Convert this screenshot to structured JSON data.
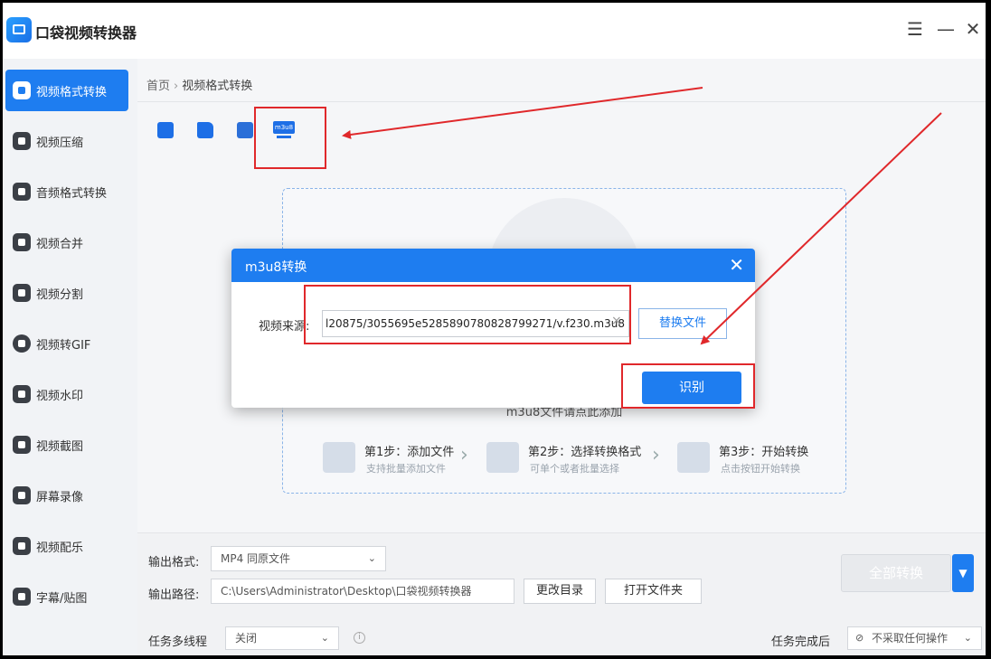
{
  "app": {
    "title": "口袋视频转换器"
  },
  "window": {
    "menu_icon": "hamburger-icon",
    "minimize_icon": "minimize-icon",
    "close_icon": "close-icon"
  },
  "sidebar": {
    "items": [
      {
        "label": "视频格式转换",
        "icon": "video-convert-icon",
        "active": true
      },
      {
        "label": "视频压缩",
        "icon": "compress-icon"
      },
      {
        "label": "音频格式转换",
        "icon": "audio-convert-icon"
      },
      {
        "label": "视频合并",
        "icon": "merge-icon"
      },
      {
        "label": "视频分割",
        "icon": "split-icon"
      },
      {
        "label": "视频转GIF",
        "icon": "gif-icon"
      },
      {
        "label": "视频水印",
        "icon": "watermark-icon"
      },
      {
        "label": "视频截图",
        "icon": "screenshot-icon"
      },
      {
        "label": "屏幕录像",
        "icon": "screen-record-icon"
      },
      {
        "label": "视频配乐",
        "icon": "music-icon"
      },
      {
        "label": "字幕/贴图",
        "icon": "subtitle-icon"
      }
    ]
  },
  "breadcrumb": {
    "home": "首页",
    "current": "视频格式转换"
  },
  "toolbar": {
    "m3u8_label": "m3u8"
  },
  "dropzone": {
    "hint": "m3u8文件请点此添加",
    "steps": [
      {
        "title": "第1步：添加文件",
        "sub": "支持批量添加文件"
      },
      {
        "title": "第2步：选择转换格式",
        "sub": "可单个或者批量选择"
      },
      {
        "title": "第3步：开始转换",
        "sub": "点击按钮开始转换"
      }
    ]
  },
  "bottom": {
    "output_format_label": "输出格式:",
    "output_format_value": "MP4  同原文件",
    "output_path_label": "输出路径:",
    "output_path_value": "C:\\Users\\Administrator\\Desktop\\口袋视频转换器",
    "change_dir": "更改目录",
    "open_folder": "打开文件夹",
    "convert_all": "全部转换",
    "multithread_label": "任务多线程",
    "multithread_value": "关闭",
    "after_done_label": "任务完成后",
    "after_done_value": "不采取任何操作"
  },
  "dialog": {
    "title": "m3u8转换",
    "source_label": "视频来源:",
    "source_value": "l20875/3055695e5285890780828799271/v.f230.m3u8",
    "replace_button": "替换文件",
    "recognize_button": "识别"
  },
  "colors": {
    "accent": "#1e7df0",
    "annotation_red": "#e0282b"
  }
}
